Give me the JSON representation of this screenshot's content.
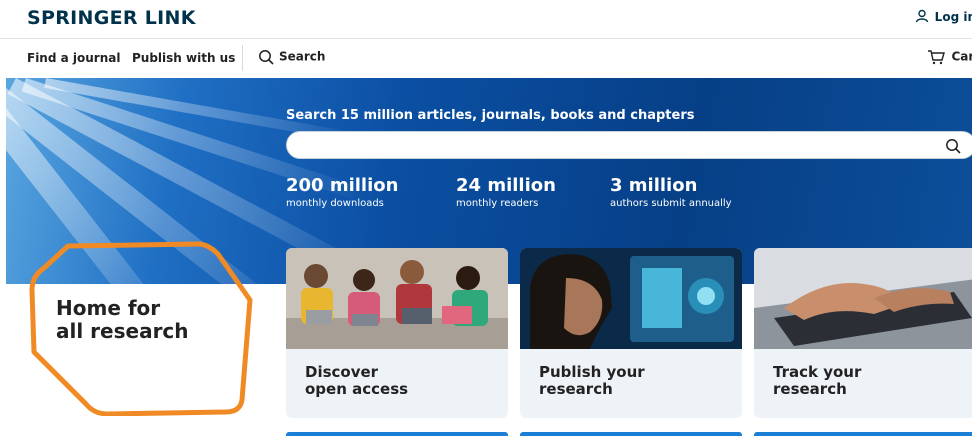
{
  "header": {
    "logo": "SPRINGER LINK",
    "login_label": "Log in"
  },
  "nav": {
    "find_journal": "Find a journal",
    "publish": "Publish with us",
    "search": "Search",
    "cart": "Cart"
  },
  "hero": {
    "title": "Search 15 million articles, journals, books and chapters",
    "search_placeholder": "",
    "stats": [
      {
        "number": "200 million",
        "label": "monthly downloads"
      },
      {
        "number": "24 million",
        "label": "monthly readers"
      },
      {
        "number": "3 million",
        "label": "authors submit annually"
      }
    ]
  },
  "home": {
    "line1": "Home for",
    "line2": "all research"
  },
  "cards": [
    {
      "line1": "Discover",
      "line2": "open access"
    },
    {
      "line1": "Publish your",
      "line2": "research"
    },
    {
      "line1": "Track your",
      "line2": "research"
    }
  ],
  "colors": {
    "brand": "#01324b",
    "hero_blue": "#0b4fa3",
    "highlight_orange": "#f08a24",
    "card_bg": "#eef3f8"
  }
}
